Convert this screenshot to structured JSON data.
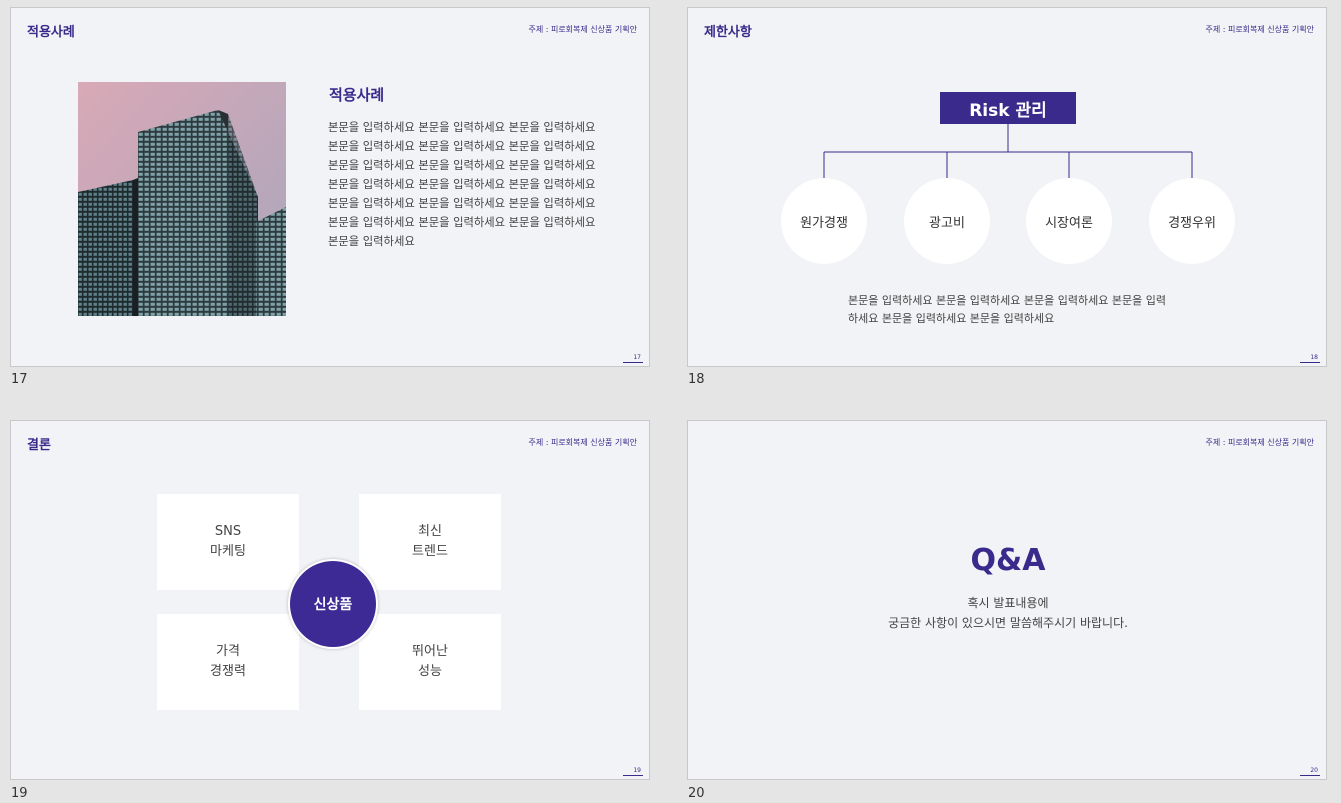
{
  "topic": "주제 : 피로회복제 신상품 기획안",
  "slides": [
    {
      "number": "17",
      "page": "17",
      "title": "적용사례",
      "heading": "적용사례",
      "body_lines": [
        "본문을 입력하세요 본문을 입력하세요 본문을 입력하세요",
        "본문을 입력하세요 본문을 입력하세요 본문을 입력하세요",
        "본문을 입력하세요 본문을 입력하세요 본문을 입력하세요",
        "본문을 입력하세요 본문을 입력하세요 본문을 입력하세요",
        "본문을 입력하세요 본문을 입력하세요 본문을 입력하세요",
        "본문을 입력하세요 본문을 입력하세요 본문을 입력하세요",
        "본문을 입력하세요"
      ]
    },
    {
      "number": "18",
      "page": "18",
      "title": "제한사항",
      "root": "Risk 관리",
      "nodes": [
        "원가경쟁",
        "광고비",
        "시장여론",
        "경쟁우위"
      ],
      "body_lines": [
        "본문을 입력하세요 본문을 입력하세요 본문을 입력하세요 본문을 입력",
        "하세요 본문을 입력하세요 본문을 입력하세요"
      ]
    },
    {
      "number": "19",
      "page": "19",
      "title": "결론",
      "center": "신상품",
      "cards": [
        {
          "line1": "SNS",
          "line2": "마케팅"
        },
        {
          "line1": "최신",
          "line2": "트렌드"
        },
        {
          "line1": "가격",
          "line2": "경쟁력"
        },
        {
          "line1": "뛰어난",
          "line2": "성능"
        }
      ]
    },
    {
      "number": "20",
      "page": "20",
      "heading": "Q&A",
      "sub_line1": "혹시 발표내용에",
      "sub_line2": "궁금한 사항이 있으시면 말씀해주시기 바랍니다."
    }
  ],
  "colors": {
    "accent": "#3a2a8c",
    "slide_bg": "#f2f3f6",
    "workspace_bg": "#e5e5e5"
  }
}
